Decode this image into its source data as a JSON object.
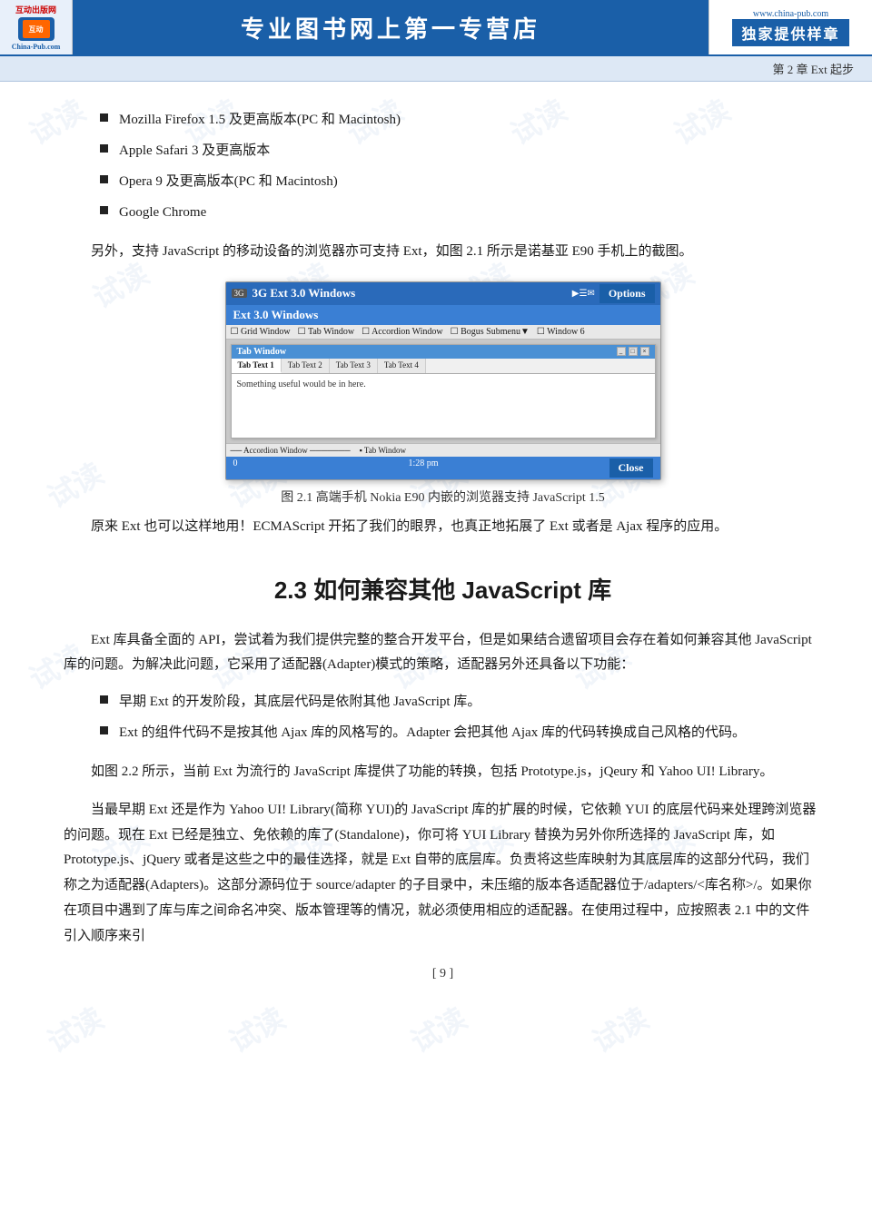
{
  "header": {
    "logo_top": "互动出版网",
    "logo_bottom": "China-Pub.com",
    "title": "专业图书网上第一专营店",
    "url": "www.china-pub.com",
    "exclusive": "独家提供样章"
  },
  "chapter_bar": {
    "text": "第 2 章   Ext 起步"
  },
  "bullet_list": {
    "items": [
      "Mozilla Firefox 1.5 及更高版本(PC 和 Macintosh)",
      "Apple Safari 3 及更高版本",
      "Opera 9 及更高版本(PC 和 Macintosh)",
      "Google Chrome"
    ]
  },
  "paragraph1": "另外，支持 JavaScript 的移动设备的浏览器亦可支持 Ext，如图 2.1 所示是诺基亚 E90 手机上的截图。",
  "figure": {
    "phone_title": "3G  Ext 3.0 Windows",
    "app_title": "Ext 3.0 Windows",
    "menu_items": [
      "Grid Window",
      "Tab Window",
      "Accordion Window",
      "Bogus Submenu▼",
      "Window 6"
    ],
    "window_title": "Tab Window",
    "tabs": [
      "Tab Text 1",
      "Tab Text 2",
      "Tab Text 3",
      "Tab Text 4"
    ],
    "content": "Something useful would be in here.",
    "bottom_bar": [
      "Accordion Window",
      "Tab Window"
    ],
    "status_count": "0",
    "status_time": "1:28 pm",
    "options_label": "Options",
    "close_label": "Close"
  },
  "figure_caption": "图 2.1    高端手机 Nokia E90 内嵌的浏览器支持 JavaScript 1.5",
  "paragraph2": "原来 Ext 也可以这样地用！ECMAScript 开拓了我们的眼界，也真正地拓展了 Ext 或者是 Ajax 程序的应用。",
  "section_heading": "2.3   如何兼容其他 JavaScript 库",
  "paragraph3": "Ext 库具备全面的 API，尝试着为我们提供完整的整合开发平台，但是如果结合遗留项目会存在着如何兼容其他 JavaScript 库的问题。为解决此问题，它采用了适配器(Adapter)模式的策略，适配器另外还具备以下功能：",
  "bullet_list2": {
    "items": [
      "早期 Ext 的开发阶段，其底层代码是依附其他 JavaScript 库。",
      "Ext 的组件代码不是按其他 Ajax 库的风格写的。Adapter 会把其他 Ajax 库的代码转换成自己风格的代码。"
    ]
  },
  "paragraph4": "如图 2.2 所示，当前 Ext 为流行的 JavaScript 库提供了功能的转换，包括 Prototype.js，jQeury 和 Yahoo UI! Library。",
  "paragraph5": "当最早期 Ext 还是作为 Yahoo UI! Library(简称 YUI)的 JavaScript 库的扩展的时候，它依赖 YUI 的底层代码来处理跨浏览器的问题。现在 Ext 已经是独立、免依赖的库了(Standalone)，你可将 YUI Library 替换为另外你所选择的 JavaScript 库，如 Prototype.js、jQuery 或者是这些之中的最佳选择，就是 Ext 自带的底层库。负责将这些库映射为其底层库的这部分代码，我们称之为适配器(Adapters)。这部分源码位于 source/adapter 的子目录中，未压缩的版本各适配器位于/adapters/<库名称>/。如果你在项目中遇到了库与库之间命名冲突、版本管理等的情况，就必须使用相应的适配器。在使用过程中，应按照表 2.1 中的文件引入顺序来引",
  "page_number": "[ 9 ]",
  "watermarks": [
    "试读",
    "试读",
    "试读",
    "试读",
    "试读",
    "试读",
    "试读",
    "试读",
    "试读",
    "试读",
    "试读",
    "试读"
  ]
}
